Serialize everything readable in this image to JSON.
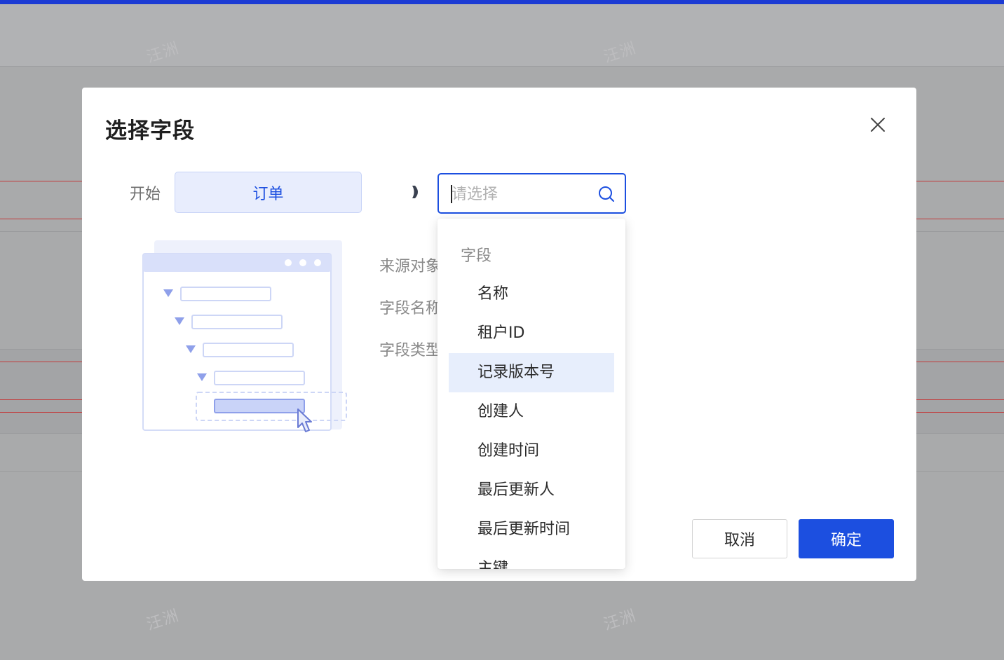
{
  "background": {
    "watermark_text": "汪洲"
  },
  "modal": {
    "title": "选择字段",
    "close_icon": "close-icon",
    "start_label": "开始",
    "start_value": "订单",
    "select": {
      "placeholder": "请选择",
      "icon": "search-icon"
    },
    "info_labels": [
      "来源对象",
      "字段名称",
      "字段类型"
    ],
    "dropdown": {
      "group_label": "字段",
      "items": [
        {
          "label": "名称",
          "active": false
        },
        {
          "label": "租户ID",
          "active": false
        },
        {
          "label": "记录版本号",
          "active": true
        },
        {
          "label": "创建人",
          "active": false
        },
        {
          "label": "创建时间",
          "active": false
        },
        {
          "label": "最后更新人",
          "active": false
        },
        {
          "label": "最后更新时间",
          "active": false
        },
        {
          "label": "主键",
          "active": false
        }
      ]
    },
    "buttons": {
      "cancel": "取消",
      "ok": "确定"
    }
  },
  "colors": {
    "primary": "#1c4fe0",
    "active_item_bg": "#e7eefc",
    "start_box_bg": "#e8edfd"
  }
}
